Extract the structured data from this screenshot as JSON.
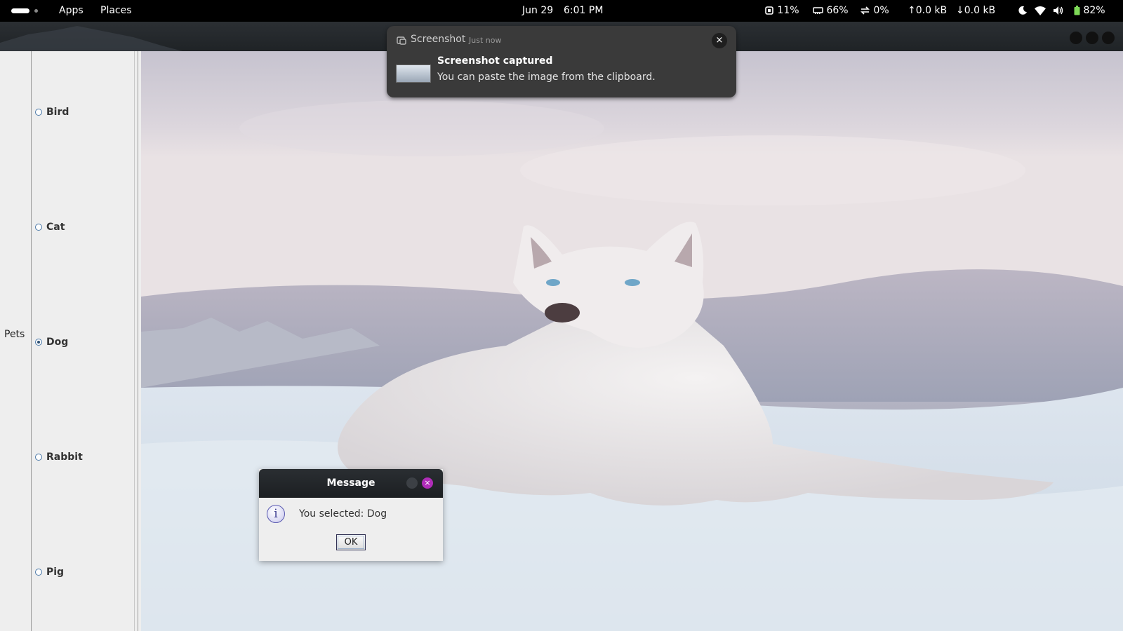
{
  "topbar": {
    "apps_label": "Apps",
    "places_label": "Places",
    "date": "Jun 29",
    "time": "6:01 PM",
    "cpu": "11%",
    "memory": "66%",
    "swap": "0%",
    "upload": "0.0 kB",
    "download": "0.0 kB",
    "battery": "82%"
  },
  "app": {
    "group_label": "Pets",
    "options": [
      "Bird",
      "Cat",
      "Dog",
      "Rabbit",
      "Pig"
    ],
    "selected": "Dog"
  },
  "notification": {
    "app_name": "Screenshot",
    "time": "Just now",
    "title": "Screenshot captured",
    "body": "You can paste the image from the clipboard.",
    "close_glyph": "×"
  },
  "dialog": {
    "title": "Message",
    "message": "You selected: Dog",
    "ok_label": "OK",
    "close_glyph": "×",
    "info_glyph": "i"
  },
  "colors": {
    "topbar_bg": "#000000",
    "notification_bg": "#3a3a3a",
    "dialog_close": "#b02cb8",
    "battery_green": "#7ed957"
  }
}
